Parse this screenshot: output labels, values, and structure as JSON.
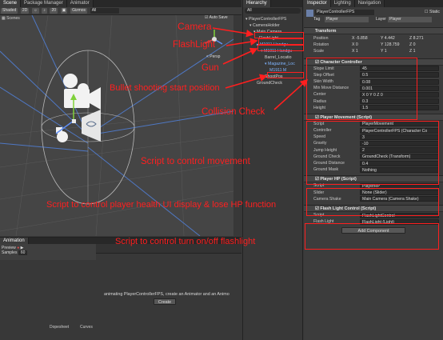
{
  "scene_tabs": {
    "scene": "Scene",
    "package_manager": "Package Manager",
    "animator": "Animator"
  },
  "scene_toolbar": {
    "shading": "Shaded",
    "mode_2d": "2D",
    "zoom": "20",
    "gizmos": "Gizmos",
    "search": "All",
    "scenes": "Scenes",
    "persp": "< Persp"
  },
  "hierarchy": {
    "tab": "Hierarchy",
    "search": "All",
    "items": [
      {
        "label": "PlayerControllerFPS"
      },
      {
        "label": "CameraHolder"
      },
      {
        "label": "Main Camera"
      },
      {
        "label": "FlashLight"
      },
      {
        "label": "M1911 Handgu"
      },
      {
        "label": "M1911 Handgu"
      },
      {
        "label": "Barrel_Locatio"
      },
      {
        "label": "Magazine_Loc"
      },
      {
        "label": "M1911 M"
      },
      {
        "label": "ShootPos"
      },
      {
        "label": "GroundCheck"
      }
    ]
  },
  "inspector": {
    "tabs": {
      "inspector": "Inspector",
      "lighting": "Lighting",
      "navigation": "Navigation"
    },
    "object_name": "PlayerControllerFPS",
    "static": "Static",
    "tag_label": "Tag",
    "tag": "Player",
    "layer_label": "Layer",
    "layer": "Player",
    "transform": {
      "title": "Transform",
      "position_label": "Position",
      "rotation_label": "Rotation",
      "scale_label": "Scale",
      "position": [
        "X -5.858",
        "Y 4.442",
        "Z 8.271"
      ],
      "rotation": [
        "X 0",
        "Y 128.759",
        "Z 0"
      ],
      "scale": [
        "X 1",
        "Y 1",
        "Z 1"
      ]
    },
    "character_controller": {
      "title": "Character Controller",
      "fields": [
        {
          "label": "Slope Limit",
          "value": "45"
        },
        {
          "label": "Step Offset",
          "value": "0.5"
        },
        {
          "label": "Skin Width",
          "value": "0.08"
        },
        {
          "label": "Min Move Distance",
          "value": "0.001"
        },
        {
          "label": "Center",
          "value": "X 0     Y 0     Z 0"
        },
        {
          "label": "Radius",
          "value": "0.3"
        },
        {
          "label": "Height",
          "value": "1.5"
        }
      ]
    },
    "player_movement": {
      "title": "Player Movement (Script)",
      "fields": [
        {
          "label": "Script",
          "value": "PlayerMovement"
        },
        {
          "label": "Controller",
          "value": "PlayerControllerFPS (Character Co"
        },
        {
          "label": "Speed",
          "value": "3"
        },
        {
          "label": "Gravity",
          "value": "-10"
        },
        {
          "label": "Jump Height",
          "value": "2"
        },
        {
          "label": "Ground Check",
          "value": "GroundCheck (Transform)"
        },
        {
          "label": "Ground Distance",
          "value": "0.4"
        },
        {
          "label": "Ground Mask",
          "value": "Nothing"
        }
      ]
    },
    "player_hp": {
      "title": "Player HP (Script)",
      "fields": [
        {
          "label": "Script",
          "value": "PlayerHP"
        },
        {
          "label": "Slider",
          "value": "None (Slider)"
        },
        {
          "label": "Camera Shake",
          "value": "Main Camera (Camera Shake)"
        }
      ]
    },
    "flash_light": {
      "title": "Flash Light Control (Script)",
      "fields": [
        {
          "label": "Script",
          "value": "FlashLightControl"
        },
        {
          "label": "Flash Light",
          "value": "FlashLight (Light)"
        }
      ]
    },
    "add_component": "Add Component"
  },
  "animation": {
    "tab": "Animation",
    "preview": "Preview",
    "samples_label": "Samples",
    "samples": "60",
    "message": "animating PlayerControllerFPS, create an Animator and an Animo",
    "create": "Create",
    "dopesheet": "Dopesheet",
    "curves": "Curves"
  },
  "annotations": {
    "camera": "Camera",
    "flashlight": "FlashLight",
    "gun": "Gun",
    "bullet": "Bullet shooting start position",
    "collision": "Collision Check",
    "movement": "Script to control movement",
    "health": "Script to control player health UI display & lose HP function",
    "flashlight_script": "Script to control turn on/off flashlight"
  },
  "colors": {
    "annotation": "#ff1f1f",
    "selection": "#2c5d87",
    "panel": "#383838"
  }
}
